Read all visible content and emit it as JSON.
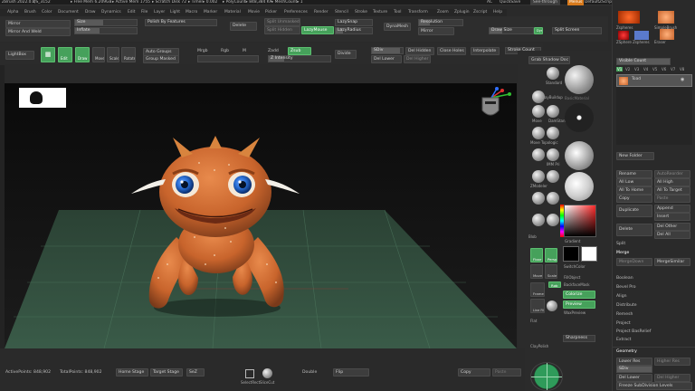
{
  "titlebar": {
    "app": "ZBrush 2022.0.2",
    "qs": "QS_3152",
    "free_mem": "▸ Free Mem 6.209GB",
    "active_mem": "▸ Active Mem 1755",
    "scratch": "▸ Scratch Disk 72",
    "timer": "▸ Timer▸ 0.002",
    "polycount": "▸ PolyCount▸ 848,384 KP",
    "meshcount": "▸ MeshCount▸ 1",
    "ac": "AC",
    "quicksave": "QuickSave",
    "see_through": "See-through",
    "menus": "Menus",
    "default_script": "DefaultZScript"
  },
  "menubar": [
    "Alpha",
    "Brush",
    "Color",
    "Document",
    "Draw",
    "Dynamics",
    "Edit",
    "File",
    "Layer",
    "Light",
    "Macro",
    "Marker",
    "Material",
    "Movie",
    "Picker",
    "Preferences",
    "Render",
    "Stencil",
    "Stroke",
    "Texture",
    "Tool",
    "Transform",
    "Zoom",
    "Zplugin",
    "Zscript",
    "Help"
  ],
  "toptool": {
    "mirror": "Mirror",
    "mirror_and_weld": "Mirror And Weld",
    "size_label": "Size",
    "inflate_label": "Inflate",
    "polish_features": "Polish By Features",
    "delete": "Delete",
    "split_unmasked": "Split Unmasked Points",
    "del_hidden_top": "Split Hidden",
    "lazymouse": "LazyMouse",
    "lazysnap": "LazySnap",
    "lazyradius": "LazyRadius",
    "dynamesh": "DynaMesh",
    "resolution": "Resolution",
    "resolution_value": "128",
    "top_mirror": "Mirror",
    "draw_size": "Draw Size",
    "draw_size_value": "64",
    "split_screen": "Split Screen",
    "dynamic": "Dynamic"
  },
  "shelf": {
    "lightbox": "LightBox",
    "edit": "Edit",
    "draw": "Draw",
    "move": "Move",
    "scale": "Scale",
    "rotate": "Rotate",
    "auto_groups": "Auto Groups",
    "group_masked": "Group Masked",
    "mrgb": "Mrgb",
    "rgb": "Rgb",
    "m": "M",
    "zadd": "Zadd",
    "zsub": "Zsub",
    "zintensity": "Z Intensity",
    "zintensity_value": "25",
    "divide": "Divide",
    "sdiv": "SDiv",
    "del_lower": "Del Lower",
    "del_higher": "Del Higher",
    "del_hidden": "Del Hidden",
    "close_holes": "Close Holes",
    "interpolate": "Interpolate",
    "stroke_count": "Stroke Count",
    "grab_shadow_doc": "Grab Shadow Doc"
  },
  "brushes": [
    {
      "name": "Standard"
    },
    {
      "name": "ClayBuildup"
    },
    {
      "name": "Move"
    },
    {
      "name": "DamStandard"
    },
    {
      "name": "Inflat"
    },
    {
      "name": "TrimDynamic"
    },
    {
      "name": "Move Topologic"
    },
    {
      "name": "hPolish"
    },
    {
      "name": "IMM Pri"
    },
    {
      "name": "Stroke Dots"
    },
    {
      "name": "ZModeler"
    },
    {
      "name": "SnakeHook"
    },
    {
      "name": "MaskLasso"
    },
    {
      "name": "SelectRect"
    },
    {
      "name": "Pinch"
    },
    {
      "name": "Blob"
    }
  ],
  "material": {
    "name": "BasicMaterial",
    "gradient": "Gradient"
  },
  "color_panel": {
    "switch_color": "SwitchColor",
    "fill_object": "FillObject",
    "backface_mask": "BackfaceMask",
    "rgb": "Rgb",
    "colorize": "Colorize",
    "preview": "Preview",
    "wax_preview": "WaxPreview",
    "main_color": "#f02020",
    "floor": "Floor",
    "persp": "Persp",
    "frame": "Frame",
    "move": "Move",
    "scale": "Scale",
    "rotate": "Rotate",
    "line_fill": "Line Fill",
    "flat": "Flat",
    "solo": "Solo",
    "transp": "Transp",
    "claypolish": "ClayPolish",
    "sharpness": "Sharpness"
  },
  "subtool": {
    "visible_count": "Visible Count",
    "visible_value": "1",
    "v_tabs": [
      "V1",
      "V2",
      "V3",
      "V4",
      "V5",
      "V6",
      "V7",
      "V8"
    ],
    "tool_names": [
      "Zspheres",
      "SimpleBrush",
      "ZSphere Zspheres",
      "Eraser"
    ],
    "item": "Toad",
    "new_folder": "New Folder",
    "rename": "Rename",
    "auto_reorder": "AutoReorder",
    "all_low": "All Low",
    "all_high": "All High",
    "all_to_home": "All To Home",
    "all_to_target": "All To Target",
    "copy": "Copy",
    "paste": "Paste",
    "duplicate": "Duplicate",
    "append": "Append",
    "insert": "Insert",
    "delete": "Delete",
    "del_other": "Del Other",
    "del_all": "Del All",
    "split": "Split",
    "merge": "Merge",
    "merge_similar": "MergeSimilar",
    "merge_down": "MergeDown",
    "boolean": "Boolean",
    "bevel_pro": "Bevel Pro",
    "align": "Align",
    "distribute": "Distribute",
    "remesh": "Remesh",
    "project": "Project",
    "project_bas_relief": "Project BasRelief",
    "extract": "Extract",
    "geometry": "Geometry",
    "lower_res": "Lower Res",
    "higher_res": "Higher Res",
    "sdiv": "SDiv",
    "sdiv_value": "6",
    "del_lower": "Del Lower",
    "del_higher": "Del Higher",
    "freeze_subdiv": "Freeze SubDivision Levels"
  },
  "bottombar": {
    "active_points": "ActivePoints: 848,902",
    "total_points": "TotalPoints: 848,902",
    "home_stage": "Home Stage",
    "target_stage": "Target Stage",
    "sel": "SeZ",
    "selectrect": "SelectRect",
    "selectlasso": "SliceCut",
    "double": "Double",
    "flip": "Flip",
    "copy": "Copy",
    "paste": "Paste"
  },
  "viewport": {
    "character": "toad creature",
    "skin_color": "#c8642c",
    "eye_color": "#2a6fd6",
    "floor_color": "#3a5a45"
  }
}
